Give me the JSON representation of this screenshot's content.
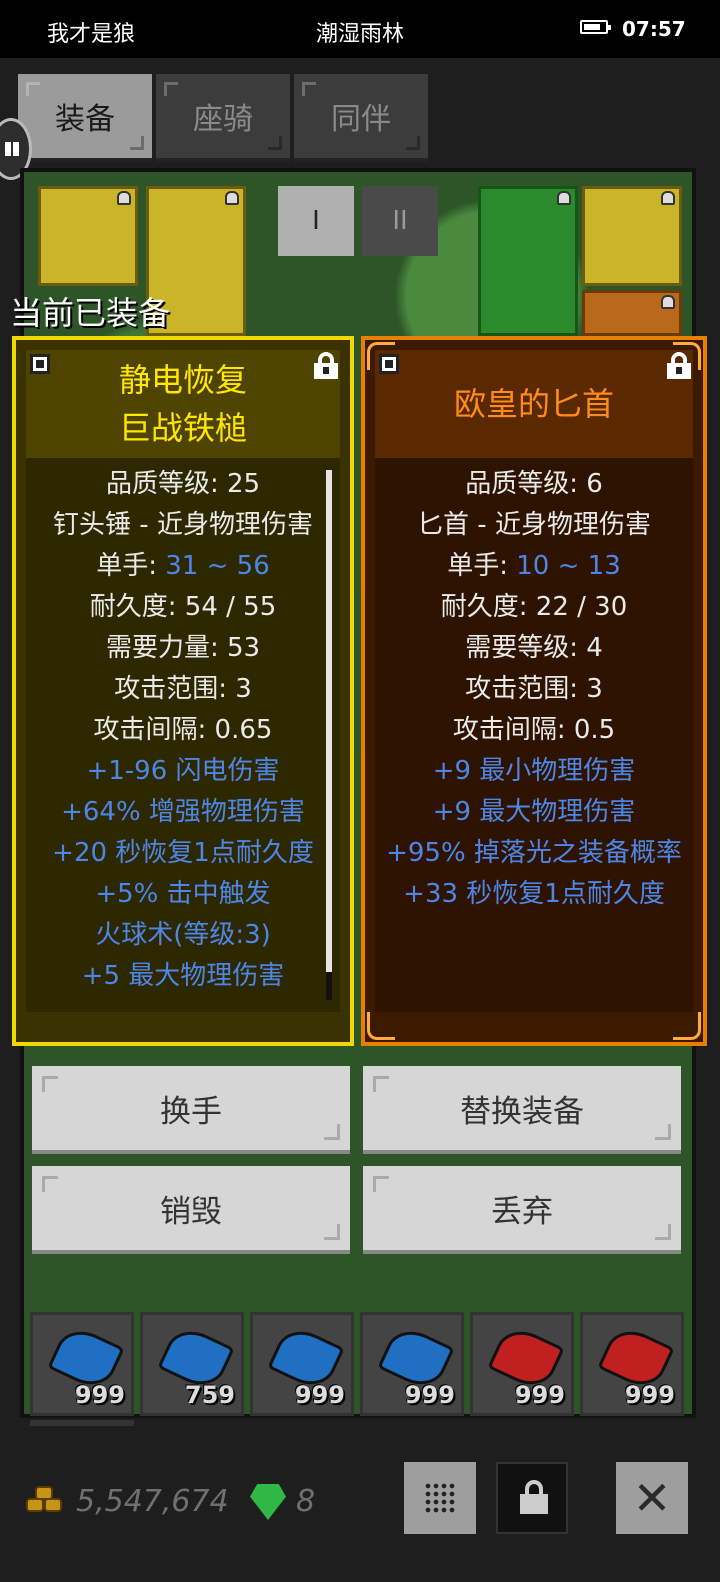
{
  "status_bar": {
    "left_text": "我才是狼",
    "location": "潮湿雨林",
    "time": "07:57"
  },
  "tabs": [
    {
      "label": "装备",
      "active": true
    },
    {
      "label": "座骑",
      "active": false
    },
    {
      "label": "同伴",
      "active": false
    }
  ],
  "page_buttons": [
    "I",
    "II"
  ],
  "section_label": "当前已装备",
  "left_card": {
    "name_line1": "静电恢复",
    "name_line2": "巨战铁槌",
    "quality": "品质等级: 25",
    "type": "钉头锤 - 近身物理伤害",
    "hand_label": "单手: ",
    "hand_value": "31 ~ 56",
    "durability": "耐久度: 54 / 55",
    "requirement": "需要力量: 53",
    "range": "攻击范围: 3",
    "interval": "攻击间隔: 0.65",
    "mods": [
      "+1-96 闪电伤害",
      "+64% 增强物理伤害",
      "+20 秒恢复1点耐久度",
      "+5% 击中触发",
      "火球术(等级:3)",
      "+5 最大物理伤害"
    ]
  },
  "right_card": {
    "name": "欧皇的匕首",
    "quality": "品质等级: 6",
    "type": "匕首 - 近身物理伤害",
    "hand_label": "单手: ",
    "hand_value": "10 ~ 13",
    "durability": "耐久度: 22 / 30",
    "requirement": "需要等级: 4",
    "range": "攻击范围: 3",
    "interval": "攻击间隔: 0.5",
    "mods": [
      "+9 最小物理伤害",
      "+9 最大物理伤害",
      "+95% 掉落光之装备概率",
      "+33 秒恢复1点耐久度"
    ]
  },
  "actions": {
    "swap_hand": "换手",
    "replace": "替换装备",
    "destroy": "销毁",
    "discard": "丢弃"
  },
  "inventory": [
    {
      "count": "999",
      "color": "blue"
    },
    {
      "count": "759",
      "color": "blue"
    },
    {
      "count": "999",
      "color": "blue"
    },
    {
      "count": "999",
      "color": "blue"
    },
    {
      "count": "999",
      "color": "red"
    },
    {
      "count": "999",
      "color": "red"
    }
  ],
  "footer": {
    "gold": "5,547,674",
    "gems": "8"
  },
  "icons": {
    "grid": "grid-icon",
    "lock": "lock-icon",
    "close": "close-icon"
  }
}
